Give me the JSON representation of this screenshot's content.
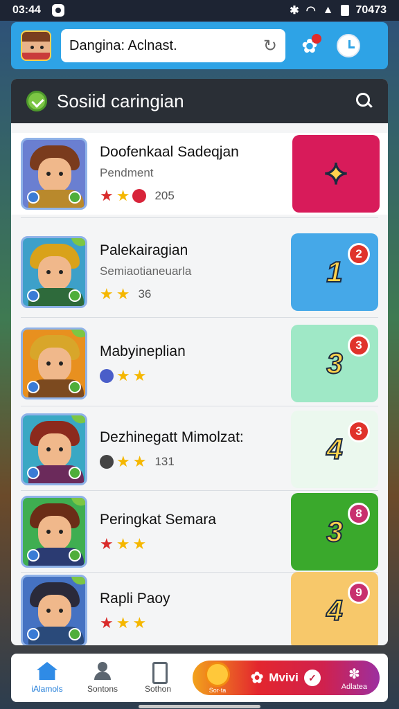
{
  "status_bar": {
    "time": "03:44",
    "right_text": "70473"
  },
  "top_bar": {
    "search_value": "Dangina: Aclnast."
  },
  "panel": {
    "title": "Sosiid caringian"
  },
  "games": [
    {
      "name": "Doofenkaal Sadeqjan",
      "subtitle": "Pendment",
      "count": "205",
      "rank": "",
      "rank_badge": "",
      "rank_color": "#d81b5a",
      "icon_colors": {
        "bg": "#6a7fd1",
        "hair": "#7a3b1d",
        "body": "#b9892c"
      }
    },
    {
      "name": "Palekairagian",
      "subtitle": "Semiaotianeuarla",
      "count": "36",
      "rank": "1",
      "rank_badge": "2",
      "rank_color": "#45a8e8",
      "icon_colors": {
        "bg": "#3da0c9",
        "hair": "#d9a21a",
        "body": "#2e6a3b"
      }
    },
    {
      "name": "Mabyineplian",
      "subtitle": "",
      "count": "",
      "rank": "3",
      "rank_badge": "3",
      "rank_color": "#9fe8c6",
      "icon_colors": {
        "bg": "#e8901f",
        "hair": "#d8a62a",
        "body": "#7c4a1f"
      }
    },
    {
      "name": "Dezhinegatt Mimolzat:",
      "subtitle": "",
      "count": "131",
      "rank": "4",
      "rank_badge": "3",
      "rank_color": "#ebf8ee",
      "icon_colors": {
        "bg": "#3aa8c4",
        "hair": "#8c2a1d",
        "body": "#6b2a5b"
      }
    },
    {
      "name": "Peringkat Semara",
      "subtitle": "",
      "count": "",
      "rank": "3",
      "rank_badge": "8",
      "rank_color": "#3aa92c",
      "icon_colors": {
        "bg": "#3fae51",
        "hair": "#6b2d17",
        "body": "#2b3b72"
      }
    },
    {
      "name": "Rapli Paoy",
      "subtitle": "",
      "count": "",
      "rank": "4",
      "rank_badge": "9",
      "rank_color": "#f7c86a",
      "icon_colors": {
        "bg": "#4572c2",
        "hair": "#2a2a3a",
        "body": "#2a4a7a"
      }
    }
  ],
  "bottom_nav": {
    "items": [
      {
        "label": "iAlamols",
        "icon": "home-icon"
      },
      {
        "label": "Sontons",
        "icon": "people-icon"
      },
      {
        "label": "Sothon",
        "icon": "phone-icon"
      }
    ],
    "promo_label": "Mvivi",
    "promo_small": "Sor·ta",
    "promo_right": "Adlatea"
  }
}
